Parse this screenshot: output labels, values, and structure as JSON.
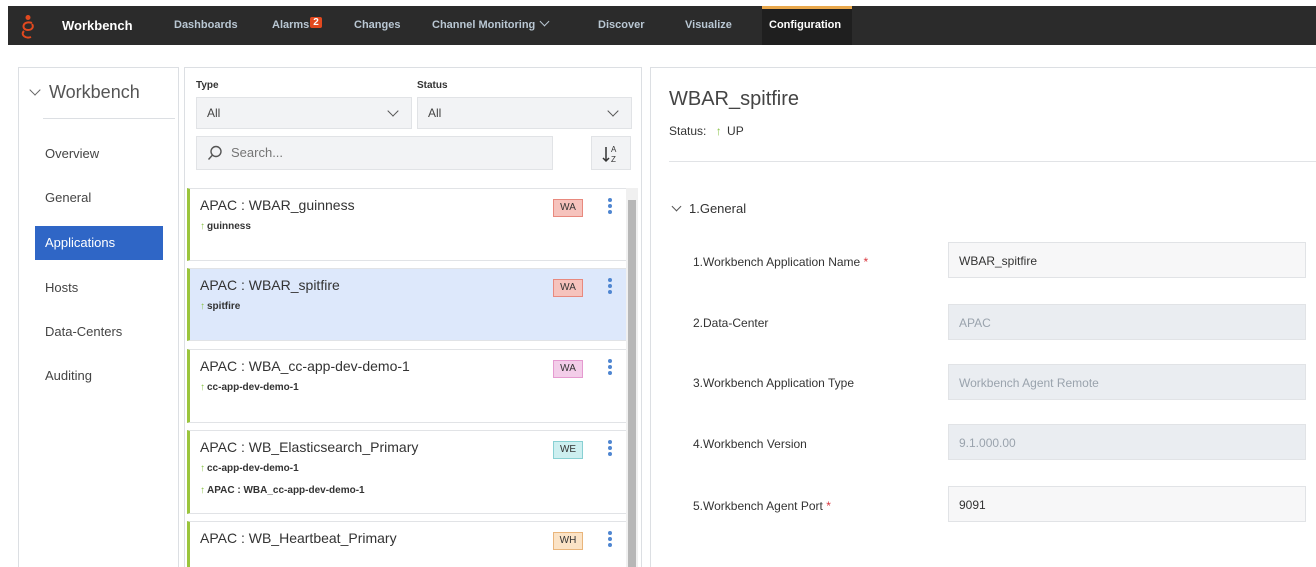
{
  "nav": {
    "brand": "Workbench",
    "items": [
      {
        "label": "Dashboards"
      },
      {
        "label": "Alarms",
        "badge": "2"
      },
      {
        "label": "Changes"
      },
      {
        "label": "Channel Monitoring"
      },
      {
        "label": "Discover"
      },
      {
        "label": "Visualize"
      },
      {
        "label": "Configuration"
      }
    ],
    "accent": "#e9a84c"
  },
  "sidebar": {
    "title": "Workbench",
    "items": [
      {
        "label": "Overview"
      },
      {
        "label": "General"
      },
      {
        "label": "Applications"
      },
      {
        "label": "Hosts"
      },
      {
        "label": "Data-Centers"
      },
      {
        "label": "Auditing"
      }
    ]
  },
  "filters": {
    "type_label": "Type",
    "type_value": "All",
    "status_label": "Status",
    "status_value": "All",
    "search_placeholder": "Search..."
  },
  "apps": [
    {
      "title": "APAC : WBAR_guinness",
      "subs": [
        "guinness"
      ],
      "tag": "WA"
    },
    {
      "title": "APAC : WBAR_spitfire",
      "subs": [
        "spitfire"
      ],
      "tag": "WA"
    },
    {
      "title": "APAC : WBA_cc-app-dev-demo-1",
      "subs": [
        "cc-app-dev-demo-1"
      ],
      "tag": "WA"
    },
    {
      "title": "APAC : WB_Elasticsearch_Primary",
      "subs": [
        "cc-app-dev-demo-1",
        "APAC : WBA_cc-app-dev-demo-1"
      ],
      "tag": "WE"
    },
    {
      "title": "APAC : WB_Heartbeat_Primary",
      "subs": [],
      "tag": "WH"
    }
  ],
  "detail": {
    "title": "WBAR_spitfire",
    "status_label": "Status:",
    "status_value": "UP",
    "section": "1.General",
    "fields": [
      {
        "label": "1.Workbench Application Name",
        "required": "*",
        "value": "WBAR_spitfire"
      },
      {
        "label": "2.Data-Center",
        "required": "",
        "value": "APAC"
      },
      {
        "label": "3.Workbench Application Type",
        "required": "",
        "value": "Workbench Agent Remote"
      },
      {
        "label": "4.Workbench Version",
        "required": "",
        "value": "9.1.000.00"
      },
      {
        "label": "5.Workbench Agent Port",
        "required": "*",
        "value": "9091"
      }
    ]
  }
}
